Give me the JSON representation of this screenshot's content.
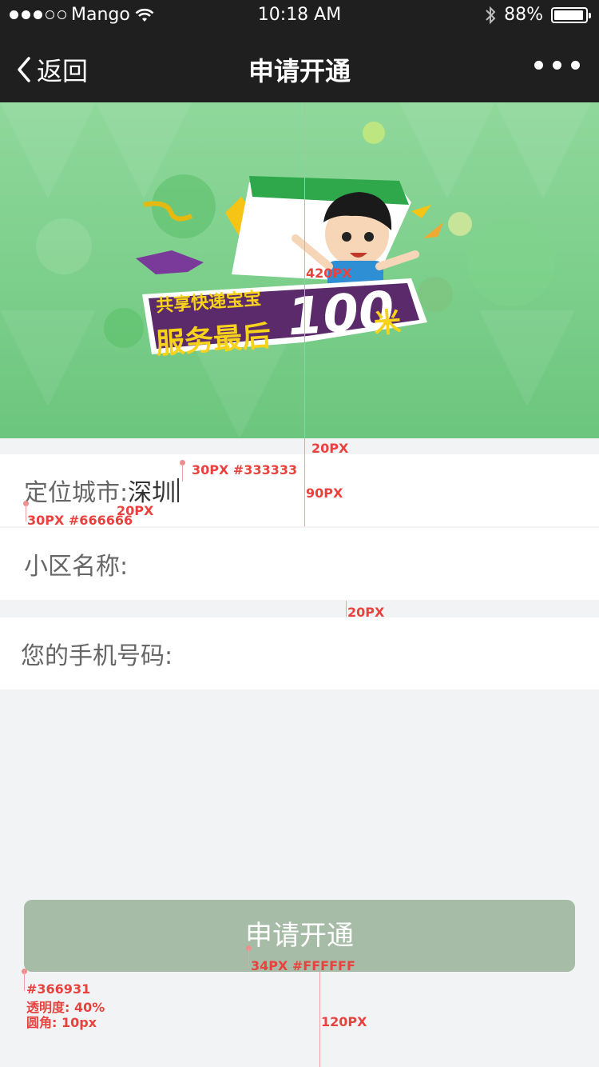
{
  "status_bar": {
    "carrier": "Mango",
    "time": "10:18 AM",
    "battery": "88%",
    "battery_level": 0.88,
    "signal_bars": 3,
    "icons": [
      "signal-dots-icon",
      "wifi-icon",
      "bluetooth-icon",
      "battery-icon"
    ]
  },
  "nav": {
    "back_label": "返回",
    "title": "申请开通",
    "icons": [
      "chevron-left-icon",
      "more-dots-icon"
    ]
  },
  "banner": {
    "line1": "共享快递宝宝",
    "line2": "服务最后",
    "number": "100",
    "unit": "米"
  },
  "form": {
    "city_label": "定位城市:",
    "city_value": "深圳",
    "community_label": "小区名称:",
    "community_value": "",
    "phone_label": "您的手机号码:",
    "phone_value": ""
  },
  "submit": {
    "label": "申请开通",
    "bg_color": "#366931",
    "opacity": 0.4
  },
  "annotations": {
    "banner_height": "420PX",
    "gap_top": "20PX",
    "value_spec": "30PX #333333",
    "row_height": "90PX",
    "label_gap": "20PX",
    "label_spec": "30PX #666666",
    "gap_mid": "20PX",
    "button_text_spec": "34PX #FFFFFF",
    "button_color": "#366931",
    "button_opacity": "透明度: 40%",
    "button_radius": "圆角: 10px",
    "button_bottom": "120PX"
  },
  "colors": {
    "nav_bg": "#1f1f1f",
    "page_bg": "#f2f3f5",
    "label": "#666666",
    "value": "#333333",
    "annotation": "#e8423f"
  }
}
